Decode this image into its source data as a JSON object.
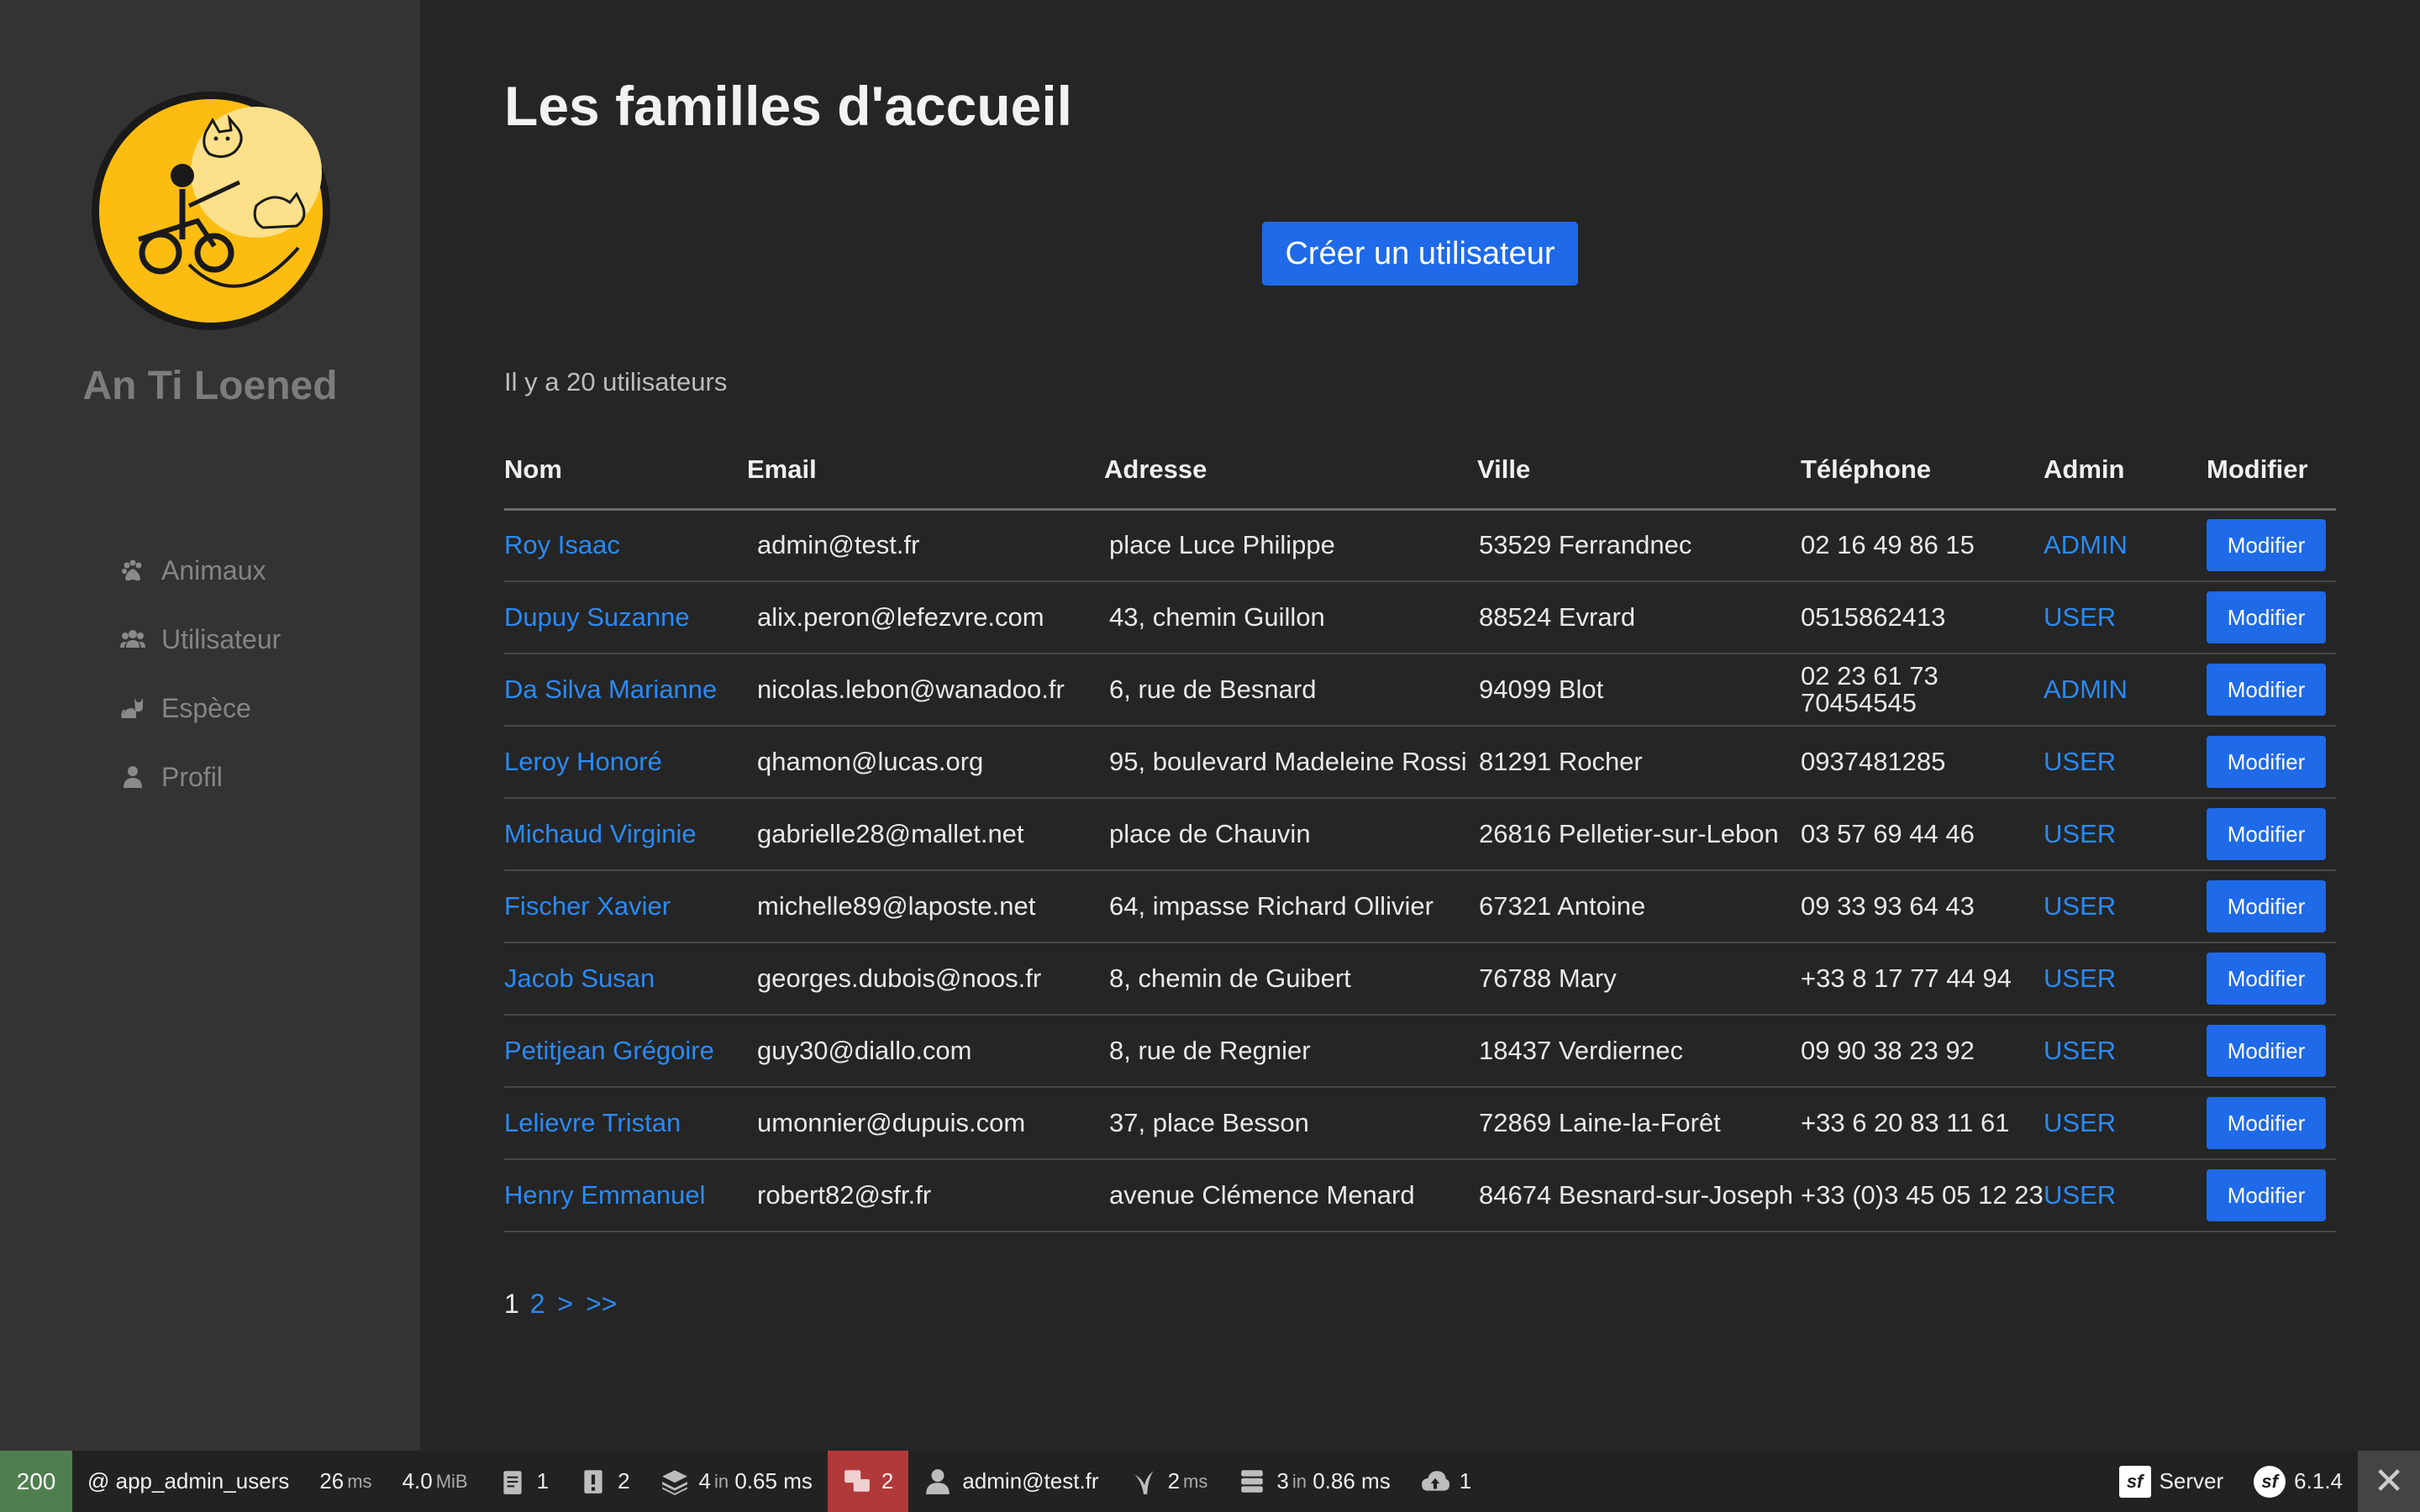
{
  "sidebar": {
    "brand": "An Ti Loened",
    "items": [
      {
        "label": "Animaux",
        "icon": "paw-icon"
      },
      {
        "label": "Utilisateur",
        "icon": "users-icon"
      },
      {
        "label": "Espèce",
        "icon": "cat-icon"
      },
      {
        "label": "Profil",
        "icon": "user-icon"
      }
    ]
  },
  "main": {
    "title": "Les familles d'accueil",
    "create_button": "Créer un utilisateur",
    "count_text": "Il y a 20 utilisateurs",
    "columns": [
      "Nom",
      "Email",
      "Adresse",
      "Ville",
      "Téléphone",
      "Admin",
      "Modifier"
    ],
    "rows": [
      {
        "nom": "Roy Isaac",
        "email": "admin@test.fr",
        "adresse": "place Luce Philippe",
        "ville": "53529 Ferrandnec",
        "tel": "02 16 49 86 15",
        "admin": "ADMIN",
        "action": "Modifier"
      },
      {
        "nom": "Dupuy Suzanne",
        "email": "alix.peron@lefezvre.com",
        "adresse": "43, chemin Guillon",
        "ville": "88524 Evrard",
        "tel": "0515862413",
        "admin": "USER",
        "action": "Modifier"
      },
      {
        "nom": "Da Silva Marianne",
        "email": "nicolas.lebon@wanadoo.fr",
        "adresse": "6, rue de Besnard",
        "ville": "94099 Blot",
        "tel": "02 23 61 73 70454545",
        "admin": "ADMIN",
        "action": "Modifier"
      },
      {
        "nom": "Leroy Honoré",
        "email": "qhamon@lucas.org",
        "adresse": "95, boulevard Madeleine Rossi",
        "ville": "81291 Rocher",
        "tel": "0937481285",
        "admin": "USER",
        "action": "Modifier"
      },
      {
        "nom": "Michaud Virginie",
        "email": "gabrielle28@mallet.net",
        "adresse": "place de Chauvin",
        "ville": "26816 Pelletier-sur-Lebon",
        "tel": "03 57 69 44 46",
        "admin": "USER",
        "action": "Modifier"
      },
      {
        "nom": "Fischer Xavier",
        "email": "michelle89@laposte.net",
        "adresse": "64, impasse Richard Ollivier",
        "ville": "67321 Antoine",
        "tel": "09 33 93 64 43",
        "admin": "USER",
        "action": "Modifier"
      },
      {
        "nom": "Jacob Susan",
        "email": "georges.dubois@noos.fr",
        "adresse": "8, chemin de Guibert",
        "ville": "76788 Mary",
        "tel": "+33 8 17 77 44 94",
        "admin": "USER",
        "action": "Modifier"
      },
      {
        "nom": "Petitjean Grégoire",
        "email": "guy30@diallo.com",
        "adresse": "8, rue de Regnier",
        "ville": "18437 Verdiernec",
        "tel": "09 90 38 23 92",
        "admin": "USER",
        "action": "Modifier"
      },
      {
        "nom": "Lelievre Tristan",
        "email": "umonnier@dupuis.com",
        "adresse": "37, place Besson",
        "ville": "72869 Laine-la-Forêt",
        "tel": "+33 6 20 83 11 61",
        "admin": "USER",
        "action": "Modifier"
      },
      {
        "nom": "Henry Emmanuel",
        "email": "robert82@sfr.fr",
        "adresse": "avenue Clémence Menard",
        "ville": "84674 Besnard-sur-Joseph",
        "tel": "+33 (0)3 45 05 12 23",
        "admin": "USER",
        "action": "Modifier"
      }
    ],
    "pager": {
      "current": "1",
      "page2": "2",
      "next": ">",
      "last": ">>"
    }
  },
  "toolbar": {
    "status": "200",
    "route": "@ app_admin_users",
    "time_value": "26",
    "time_unit": "ms",
    "memory_value": "4.0",
    "memory_unit": "MiB",
    "logs": "1",
    "warnings": "2",
    "cache_count": "4",
    "cache_in": "in",
    "cache_time": "0.65 ms",
    "translations": "2",
    "user": "admin@test.fr",
    "twig_value": "2",
    "twig_unit": "ms",
    "db_count": "3",
    "db_in": "in",
    "db_time": "0.86 ms",
    "http_calls": "1",
    "server": "Server",
    "version": "6.1.4",
    "sf_glyph": "sf",
    "close": "✕",
    "colors": {
      "status_ok": "#4f7f4f",
      "error": "#b03a3a",
      "accent": "#1f6ae8",
      "link": "#2b8af5"
    }
  }
}
